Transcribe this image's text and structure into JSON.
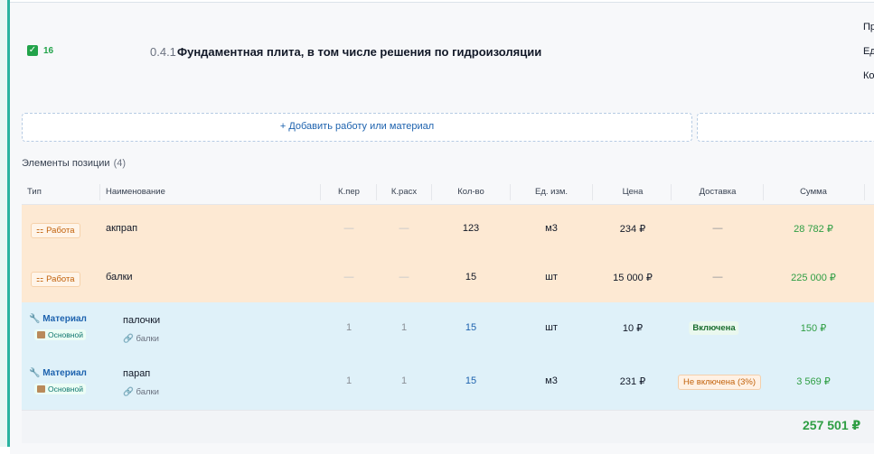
{
  "position": {
    "badge_count": "16",
    "code": "0.4.1",
    "title": "Фундаментная плита, в том числе решения по гидроизоляции",
    "right_labels": [
      "Пр",
      "Ед",
      "Ко"
    ]
  },
  "actions": {
    "add_label": "Добавить работу или материал"
  },
  "elements": {
    "title": "Элементы позиции",
    "count": "(4)",
    "columns": {
      "type": "Тип",
      "name": "Наименование",
      "k_per": "К.пер",
      "k_rash": "К.расх",
      "qty": "Кол-во",
      "unit": "Ед. изм.",
      "price": "Цена",
      "delivery": "Доставка",
      "sum": "Сумма"
    },
    "rows": [
      {
        "type": "Работа",
        "name": "акпрап",
        "k_per": "—",
        "k_rash": "—",
        "qty": "123",
        "unit": "м3",
        "price": "234 ₽",
        "delivery": "—",
        "sum": "28 782 ₽"
      },
      {
        "type": "Работа",
        "name": "балки",
        "k_per": "—",
        "k_rash": "—",
        "qty": "15",
        "unit": "шт",
        "price": "15 000 ₽",
        "delivery": "—",
        "sum": "225 000 ₽"
      },
      {
        "type": "Материал",
        "subtype": "Основной",
        "name": "палочки",
        "parent": "балки",
        "k_per": "1",
        "k_rash": "1",
        "qty": "15",
        "unit": "шт",
        "price": "10 ₽",
        "delivery": "Включена",
        "sum": "150 ₽"
      },
      {
        "type": "Материал",
        "subtype": "Основной",
        "name": "парап",
        "parent": "балки",
        "k_per": "1",
        "k_rash": "1",
        "qty": "15",
        "unit": "м3",
        "price": "231 ₽",
        "delivery": "Не включена (3%)",
        "sum": "3 569 ₽"
      }
    ],
    "total": "257 501 ₽"
  }
}
